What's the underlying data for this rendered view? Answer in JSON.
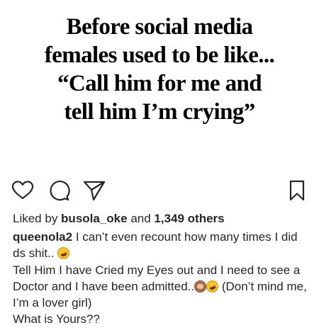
{
  "post": {
    "image_text_lines": [
      "Before social media",
      "females used to be like...",
      "“Call him for me and",
      "tell him I’m crying”"
    ]
  },
  "actions": {
    "like_icon": "heart-outline-icon",
    "comment_icon": "comment-bubble-icon",
    "share_icon": "paper-plane-icon",
    "save_icon": "bookmark-outline-icon"
  },
  "likes": {
    "prefix": "Liked by ",
    "user": "busola_oke",
    "middle": " and ",
    "count": "1,349 others"
  },
  "caption": {
    "username": "queenola2",
    "line1": " I can’t even recount how many times I did ds shit.. ",
    "line2": "Tell Him I have Cried my Eyes out and I need to see a Doctor and I  have been admitted..",
    "line3": " (Don’t mind me, I’m a lover girl)",
    "line4": "What is Yours??",
    "emoji_names": [
      "rofl-emoji",
      "see-no-evil-monkey-emoji",
      "rofl-emoji"
    ]
  }
}
